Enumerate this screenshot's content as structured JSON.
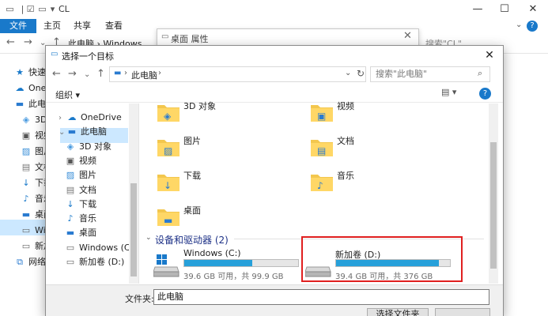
{
  "bg_explorer": {
    "title": "CL",
    "ribbon_tabs": [
      "文件",
      "主页",
      "共享",
      "查看"
    ],
    "breadcrumb": "此电脑 › Windows",
    "search_placeholder": "搜索\"CL\"",
    "nav_items": [
      {
        "label": "快速访",
        "icon": "star-icon"
      },
      {
        "label": "OneD",
        "icon": "cloud-icon"
      },
      {
        "label": "此电脑",
        "icon": "pc-icon"
      },
      {
        "label": "3D",
        "icon": "cube-icon"
      },
      {
        "label": "视频",
        "icon": "video-icon"
      },
      {
        "label": "图片",
        "icon": "picture-icon"
      },
      {
        "label": "文档",
        "icon": "document-icon"
      },
      {
        "label": "下载",
        "icon": "download-icon"
      },
      {
        "label": "音乐",
        "icon": "music-icon"
      },
      {
        "label": "桌面",
        "icon": "desktop-icon"
      },
      {
        "label": "Win",
        "icon": "drive-icon"
      },
      {
        "label": "新加",
        "icon": "drive-icon"
      },
      {
        "label": "网络",
        "icon": "network-icon"
      }
    ]
  },
  "props_dialog": {
    "title": "桌面 属性"
  },
  "dialog": {
    "title": "选择一个目标",
    "address": "此电脑",
    "search_placeholder": "搜索\"此电脑\"",
    "organize_label": "组织 ▾",
    "nav_items": [
      {
        "label": "OneDrive",
        "icon": "cloud-icon"
      },
      {
        "label": "此电脑",
        "icon": "pc-icon"
      },
      {
        "label": "3D 对象",
        "icon": "cube-icon"
      },
      {
        "label": "视频",
        "icon": "video-icon"
      },
      {
        "label": "图片",
        "icon": "picture-icon"
      },
      {
        "label": "文档",
        "icon": "document-icon"
      },
      {
        "label": "下载",
        "icon": "download-icon"
      },
      {
        "label": "音乐",
        "icon": "music-icon"
      },
      {
        "label": "桌面",
        "icon": "desktop-icon"
      },
      {
        "label": "Windows (C:)",
        "icon": "drive-icon"
      },
      {
        "label": "新加卷 (D:)",
        "icon": "drive-icon"
      }
    ],
    "folders": [
      {
        "label": "3D 对象",
        "icon": "cube-folder-icon"
      },
      {
        "label": "视频",
        "icon": "video-folder-icon"
      },
      {
        "label": "图片",
        "icon": "picture-folder-icon"
      },
      {
        "label": "文档",
        "icon": "document-folder-icon"
      },
      {
        "label": "下载",
        "icon": "download-folder-icon"
      },
      {
        "label": "音乐",
        "icon": "music-folder-icon"
      },
      {
        "label": "桌面",
        "icon": "desktop-folder-icon"
      }
    ],
    "drives_group": "设备和驱动器 (2)",
    "drives": [
      {
        "label": "Windows (C:)",
        "size": "39.6 GB 可用，共 99.9 GB",
        "used_fraction": 0.6
      },
      {
        "label": "新加卷 (D:)",
        "size": "39.4 GB 可用，共 376 GB",
        "used_fraction": 0.9
      }
    ],
    "folder_label": "文件夹:",
    "folder_value": "此电脑",
    "select_button": "选择文件夹",
    "colors": {
      "accent": "#1979ca",
      "bar": "#26a0da",
      "highlight": "#e02020",
      "selection": "#cce8ff"
    }
  }
}
